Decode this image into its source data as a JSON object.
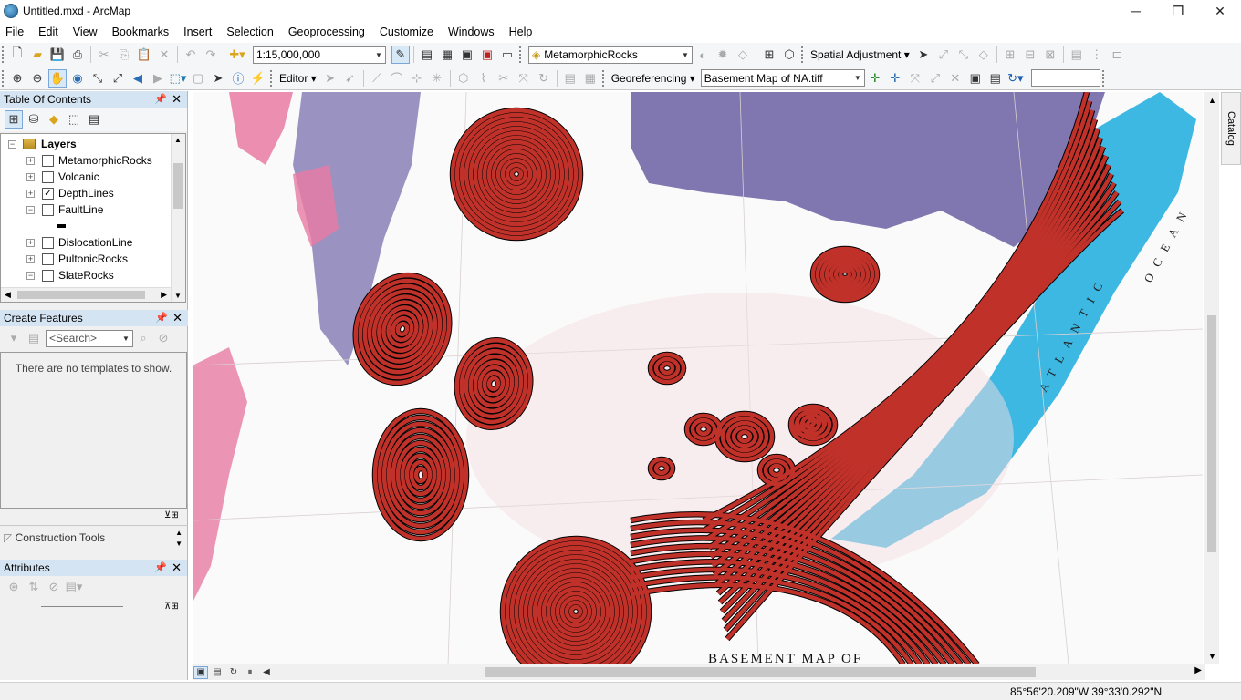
{
  "window": {
    "title": "Untitled.mxd - ArcMap"
  },
  "menu": [
    "File",
    "Edit",
    "View",
    "Bookmarks",
    "Insert",
    "Selection",
    "Geoprocessing",
    "Customize",
    "Windows",
    "Help"
  ],
  "toolbar": {
    "scale": "1:15,000,000",
    "target_layer": "MetamorphicRocks",
    "spatial_adjustment_label": "Spatial Adjustment",
    "editor_label": "Editor",
    "georeferencing_label": "Georeferencing",
    "georef_layer": "Basement Map of NA.tiff"
  },
  "toc": {
    "title": "Table Of Contents",
    "root_label": "Layers",
    "layers": [
      {
        "name": "MetamorphicRocks",
        "checked": false
      },
      {
        "name": "Volcanic",
        "checked": false
      },
      {
        "name": "DepthLines",
        "checked": true
      },
      {
        "name": "FaultLine",
        "checked": false
      },
      {
        "name": "DislocationLine",
        "checked": false
      },
      {
        "name": "PultonicRocks",
        "checked": false
      },
      {
        "name": "SlateRocks",
        "checked": false
      }
    ]
  },
  "create_features": {
    "title": "Create Features",
    "search_placeholder": "<Search>",
    "empty_message": "There are no templates to show."
  },
  "construction_tools": {
    "title": "Construction Tools"
  },
  "attributes": {
    "title": "Attributes"
  },
  "catalog": {
    "label": "Catalog"
  },
  "map": {
    "caption": "BASEMENT MAP OF",
    "ocean_label": "ATLANTIC",
    "ocean_label_2": "OCEAN",
    "colors": {
      "contour": "#c0312a",
      "metamorphic": "#6a5fa3",
      "slate": "#27b0e0",
      "volcanic": "#e87aa2"
    }
  },
  "status": {
    "coordinates": "85°56'20.209\"W  39°33'0.292\"N"
  }
}
